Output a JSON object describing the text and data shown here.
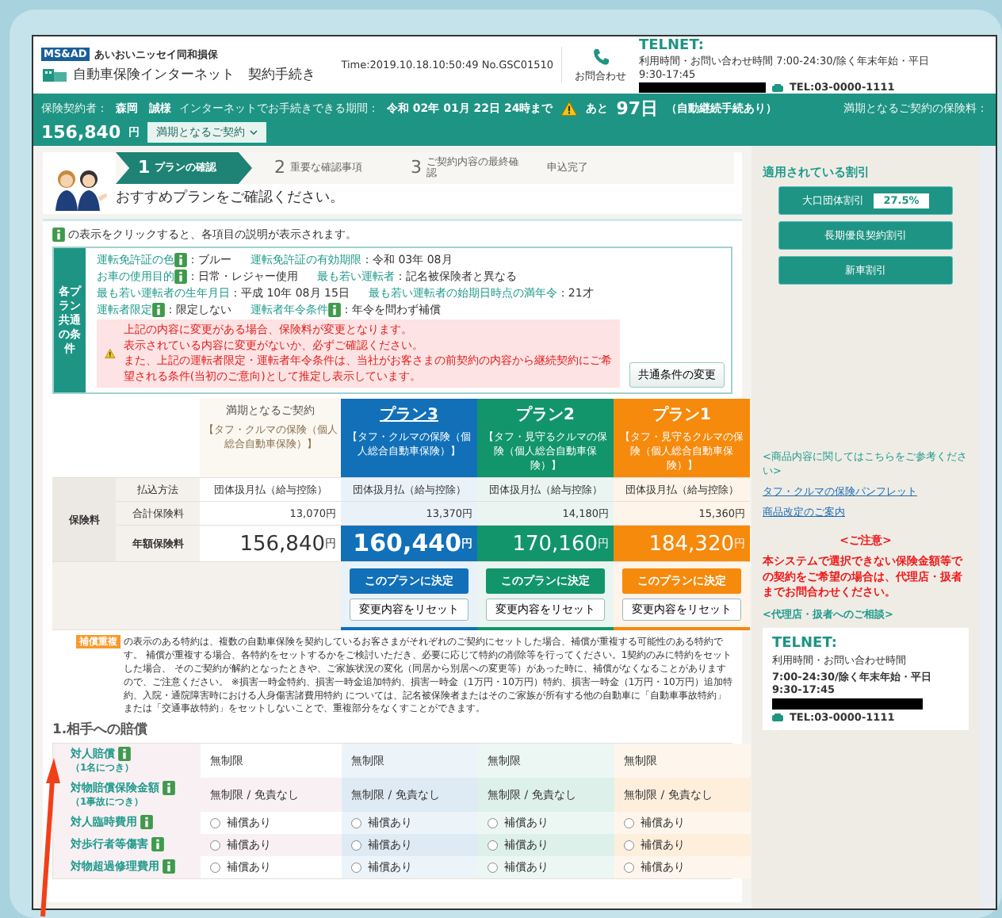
{
  "header": {
    "group_name": "あいおいニッセイ同和損保",
    "brand_badge": "MS&AD",
    "site_title": "自動車保険インターネット　契約手続き",
    "time": "Time:2019.10.18.10:50:49 No.GSC01510",
    "contact_label": "お問合わせ",
    "telnet_title": "TELNET:",
    "telnet_hours": "利用時間・お問い合わせ時間 7:00-24:30/除く年末年始・平日",
    "telnet_hours_2": "9:30-17:45",
    "tel": "TEL:03-0000-1111"
  },
  "info_bar": {
    "holder_label": "保険契約者：",
    "holder": "森岡　誠様",
    "period_label": "インターネットでお手続きできる期間：",
    "period": "令和 02年 01月 22日 24時まで",
    "remaining_prefix": "あと",
    "remaining_days": "97日",
    "remaining_note": "（自動継続手続あり）",
    "premium_label": "満期となるご契約の保険料：",
    "premium": "156,840",
    "premium_unit": "円",
    "dropdown": "満期となるご契約"
  },
  "steps": [
    {
      "number": "1",
      "label": "プランの確認",
      "selected": true
    },
    {
      "number": "2",
      "label": "重要な確認事項",
      "selected": false
    },
    {
      "number": "3",
      "label": "ご契約内容の最終確認",
      "selected": false
    },
    {
      "label": "申込完了",
      "selected": false
    }
  ],
  "page_heading": "おすすめプランをご確認ください。",
  "info_hint": "の表示をクリックすると、各項目の説明が表示されます。",
  "conditions": {
    "title": "各プラン共通の条件",
    "lines": [
      [
        {
          "label": "運転免許証の色",
          "info": true,
          "value": "：ブルー"
        },
        {
          "label": "運転免許証の有効期限",
          "info": false,
          "value": "：令和 03年 08月"
        }
      ],
      [
        {
          "label": "お車の使用目的",
          "info": true,
          "value": "：日常・レジャー使用"
        },
        {
          "label": "最も若い運転者",
          "info": false,
          "value": "：記名被保険者と異なる"
        }
      ],
      [
        {
          "label": "最も若い運転者の生年月日",
          "info": false,
          "value": "：平成 10年 08月 15日"
        },
        {
          "label": "最も若い運転者の始期日時点の満年令",
          "info": false,
          "value": "：21才"
        }
      ],
      [
        {
          "label": "運転者限定",
          "info": true,
          "value": "：限定しない"
        },
        {
          "label": "運転者年令条件",
          "info": true,
          "value": "：年令を問わず補償"
        }
      ]
    ],
    "alert": [
      "上記の内容に変更がある場合、保険料が変更となります。",
      "表示されている内容に変更がないか、必ずご確認ください。",
      "また、上記の運転者限定・運転者年令条件は、当社がお客さまの前契約の内容から継続契約にご希望される条件(当初のご意向)として推定し表示しています。"
    ],
    "change_button": "共通条件の変更"
  },
  "plans": [
    {
      "name": "満期となるご契約",
      "product": "【タフ・クルマの保険（個人総合自動車保険）】",
      "color": "#fbf7f1",
      "kind": "current",
      "selected": false
    },
    {
      "name": "プラン3",
      "product": "【タフ・クルマの保険（個人総合自動車保険）】",
      "color": "#1170b8",
      "kind": "plan",
      "selected": true,
      "decide_button": "このプランに決定",
      "reset_button": "変更内容をリセット"
    },
    {
      "name": "プラン2",
      "product": "【タフ・見守るクルマの保険（個人総合自動車保険）】",
      "color": "#12956a",
      "kind": "plan",
      "selected": false,
      "decide_button": "このプランに決定",
      "reset_button": "変更内容をリセット"
    },
    {
      "name": "プラン1",
      "product": "【タフ・見守るクルマの保険（個人総合自動車保険）】",
      "color": "#f58a0d",
      "kind": "plan",
      "selected": false,
      "decide_button": "このプランに決定",
      "reset_button": "変更内容をリセット"
    }
  ],
  "premium_group": "保険料",
  "premium_rows": [
    {
      "label": "払込方法",
      "kind": "text",
      "values": [
        "団体扱月払（給与控除）",
        "団体扱月払（給与控除）",
        "団体扱月払（給与控除）",
        "団体扱月払（給与控除）"
      ]
    },
    {
      "label": "合計保険料",
      "kind": "amount",
      "values": [
        "13,070円",
        "13,370円",
        "14,180円",
        "15,360円"
      ]
    },
    {
      "label": "年額保険料",
      "kind": "annual",
      "values": [
        {
          "amount": "156,840",
          "unit": "円"
        },
        {
          "amount": "160,440",
          "unit": "円"
        },
        {
          "amount": "170,160",
          "unit": "円"
        },
        {
          "amount": "184,320",
          "unit": "円"
        }
      ]
    }
  ],
  "notes": {
    "badge": "補償重複",
    "lines": [
      "の表示のある特約は、複数の自動車保険を契約しているお客さまがそれぞれのご契約にセットした場合、補償が重複する可能性のある特約です。",
      "補償が重複する場合、各特約をセットするかをご検討いただき、必要に応じて特約の削除等を行ってください。1契約のみに特約をセットした場合、",
      "そのご契約が解約となったときや、ご家族状況の変化（同居から別居への変更等）があった時に、補償がなくなることがありますので、ご注意ください。",
      "※損害一時金特約、損害一時金追加特約、損害一時金（1万円・10万円）特約、損害一時金（1万円・10万円）追加特約、入院・通院障害時における人身傷害諸費用特約",
      "については、記名被保険者またはそのご家族が所有する他の自動車に「自動車事故特約」または「交通事故特約」をセットしないことで、重複部分をなくすことができます。"
    ]
  },
  "section_heading": "1.相手への賠償",
  "coverage_rows": [
    {
      "label": "対人賠償",
      "sub": "（1名につき）",
      "cells": [
        {
          "kind": "text",
          "label": "無制限"
        },
        {
          "kind": "text",
          "label": "無制限"
        },
        {
          "kind": "text",
          "label": "無制限"
        },
        {
          "kind": "text",
          "label": "無制限"
        }
      ]
    },
    {
      "label": "対物賠償保険金額",
      "sub": "（1事故につき）",
      "cells": [
        {
          "kind": "text",
          "label": "無制限 / 免責なし"
        },
        {
          "kind": "text",
          "label": "無制限 / 免責なし"
        },
        {
          "kind": "text",
          "label": "無制限 / 免責なし"
        },
        {
          "kind": "text",
          "label": "無制限 / 免責なし"
        }
      ]
    },
    {
      "label": "対人臨時費用",
      "cells": [
        {
          "kind": "radio",
          "label": "補償あり",
          "selected": false
        },
        {
          "kind": "radio",
          "label": "補償あり",
          "selected": false
        },
        {
          "kind": "radio",
          "label": "補償あり",
          "selected": false
        },
        {
          "kind": "radio",
          "label": "補償あり",
          "selected": false
        }
      ]
    },
    {
      "label": "対歩行者等傷害",
      "cells": [
        {
          "kind": "radio",
          "label": "補償あり",
          "selected": false
        },
        {
          "kind": "radio",
          "label": "補償あり",
          "selected": false
        },
        {
          "kind": "radio",
          "label": "補償あり",
          "selected": false
        },
        {
          "kind": "radio",
          "label": "補償あり",
          "selected": false
        }
      ]
    },
    {
      "label": "対物超過修理費用",
      "cells": [
        {
          "kind": "radio",
          "label": "補償あり",
          "selected": false
        },
        {
          "kind": "radio",
          "label": "補償あり",
          "selected": false
        },
        {
          "kind": "radio",
          "label": "補償あり",
          "selected": false
        },
        {
          "kind": "radio",
          "label": "補償あり",
          "selected": false
        }
      ]
    }
  ],
  "sidebar": {
    "discount_title": "適用されている割引",
    "discounts": [
      {
        "label": "大口団体割引",
        "value": "27.5%"
      },
      {
        "label": "長期優良契約割引"
      },
      {
        "label": "新車割引"
      }
    ],
    "product_title": "<商品内容に関してはこちらをご参考ください>",
    "links": [
      "タフ・クルマの保険パンフレット",
      "商品改定のご案内"
    ],
    "notice_title": "<ご注意>",
    "notice": "本システムで選択できない保険金額等での契約をご希望の場合は、代理店・扱者までお問合わせください。",
    "consult_title": "<代理店・扱者へのご相談>",
    "telnet_title": "TELNET:",
    "telnet_hours": "利用時間・お問い合わせ時間",
    "telnet_hours_2": "7:00-24:30/除く年末年始・平日 9:30-17:45",
    "tel": "TEL:03-0000-1111"
  }
}
